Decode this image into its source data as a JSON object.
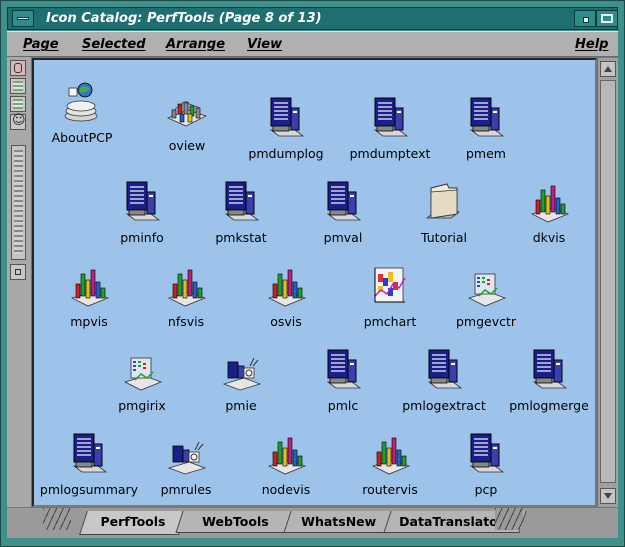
{
  "window": {
    "title": "Icon Catalog: PerfTools (Page 8 of 13)"
  },
  "menubar": {
    "page": "Page",
    "selected": "Selected",
    "arrange": "Arrange",
    "view": "View",
    "help": "Help"
  },
  "icons": [
    {
      "label": "AboutPCP",
      "type": "about"
    },
    {
      "label": "oview",
      "type": "oview"
    },
    {
      "label": "pmdumplog",
      "type": "monitor"
    },
    {
      "label": "pmdumptext",
      "type": "monitor"
    },
    {
      "label": "pmem",
      "type": "monitor"
    },
    {
      "label": "pminfo",
      "type": "monitor"
    },
    {
      "label": "pmkstat",
      "type": "monitor"
    },
    {
      "label": "pmval",
      "type": "monitor"
    },
    {
      "label": "Tutorial",
      "type": "folder"
    },
    {
      "label": "dkvis",
      "type": "bars3d"
    },
    {
      "label": "mpvis",
      "type": "bars3d"
    },
    {
      "label": "nfsvis",
      "type": "bars3d"
    },
    {
      "label": "osvis",
      "type": "bars3d"
    },
    {
      "label": "pmchart",
      "type": "chart"
    },
    {
      "label": "pmgevctr",
      "type": "gauge"
    },
    {
      "label": "pmgirix",
      "type": "gauge"
    },
    {
      "label": "pmie",
      "type": "pmie"
    },
    {
      "label": "pmlc",
      "type": "monitor"
    },
    {
      "label": "pmlogextract",
      "type": "monitor"
    },
    {
      "label": "pmlogmerge",
      "type": "monitor"
    },
    {
      "label": "pmlogsummary",
      "type": "monitor"
    },
    {
      "label": "pmrules",
      "type": "pmie"
    },
    {
      "label": "nodevis",
      "type": "bars3d"
    },
    {
      "label": "routervis",
      "type": "bars3d"
    },
    {
      "label": "pcp",
      "type": "monitor"
    }
  ],
  "tabs": [
    {
      "label": "PerfTools",
      "active": true
    },
    {
      "label": "WebTools",
      "active": false
    },
    {
      "label": "WhatsNew",
      "active": false
    },
    {
      "label": "DataTranslators",
      "active": false
    }
  ],
  "colors": {
    "pane_background": "#9ec3eb",
    "title_bar": "#1f6f70",
    "window_frame": "#3f8f8a"
  }
}
